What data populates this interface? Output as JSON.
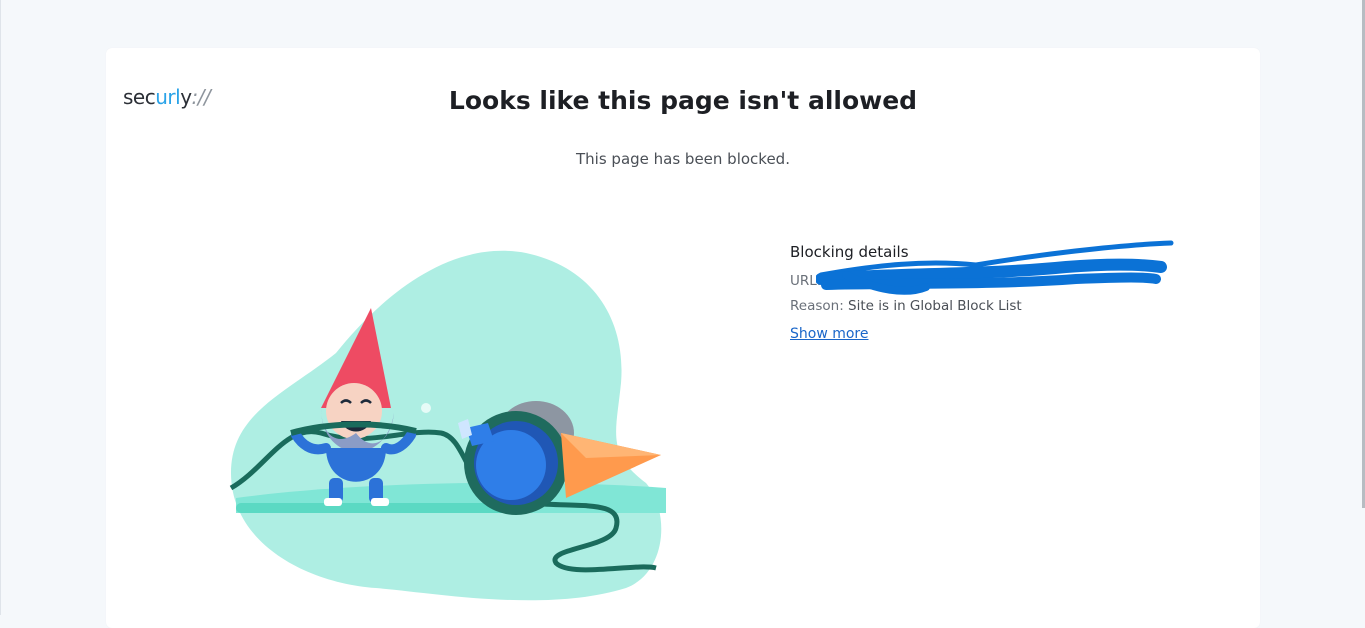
{
  "brand": {
    "logo_part1": "sec",
    "logo_part2": "url",
    "logo_part3": "y",
    "logo_part4": "://",
    "accent_color": "#2aa3e8"
  },
  "page": {
    "title": "Looks like this page isn't allowed",
    "subtitle": "This page has been blocked."
  },
  "details": {
    "heading": "Blocking details",
    "url_label": "URL:",
    "url_value": "",
    "reason_label": "Reason:",
    "reason_value": "Site is in Global Block List",
    "show_more": "Show more"
  },
  "colors": {
    "link": "#1a66c9",
    "redaction": "#0b72d6"
  }
}
